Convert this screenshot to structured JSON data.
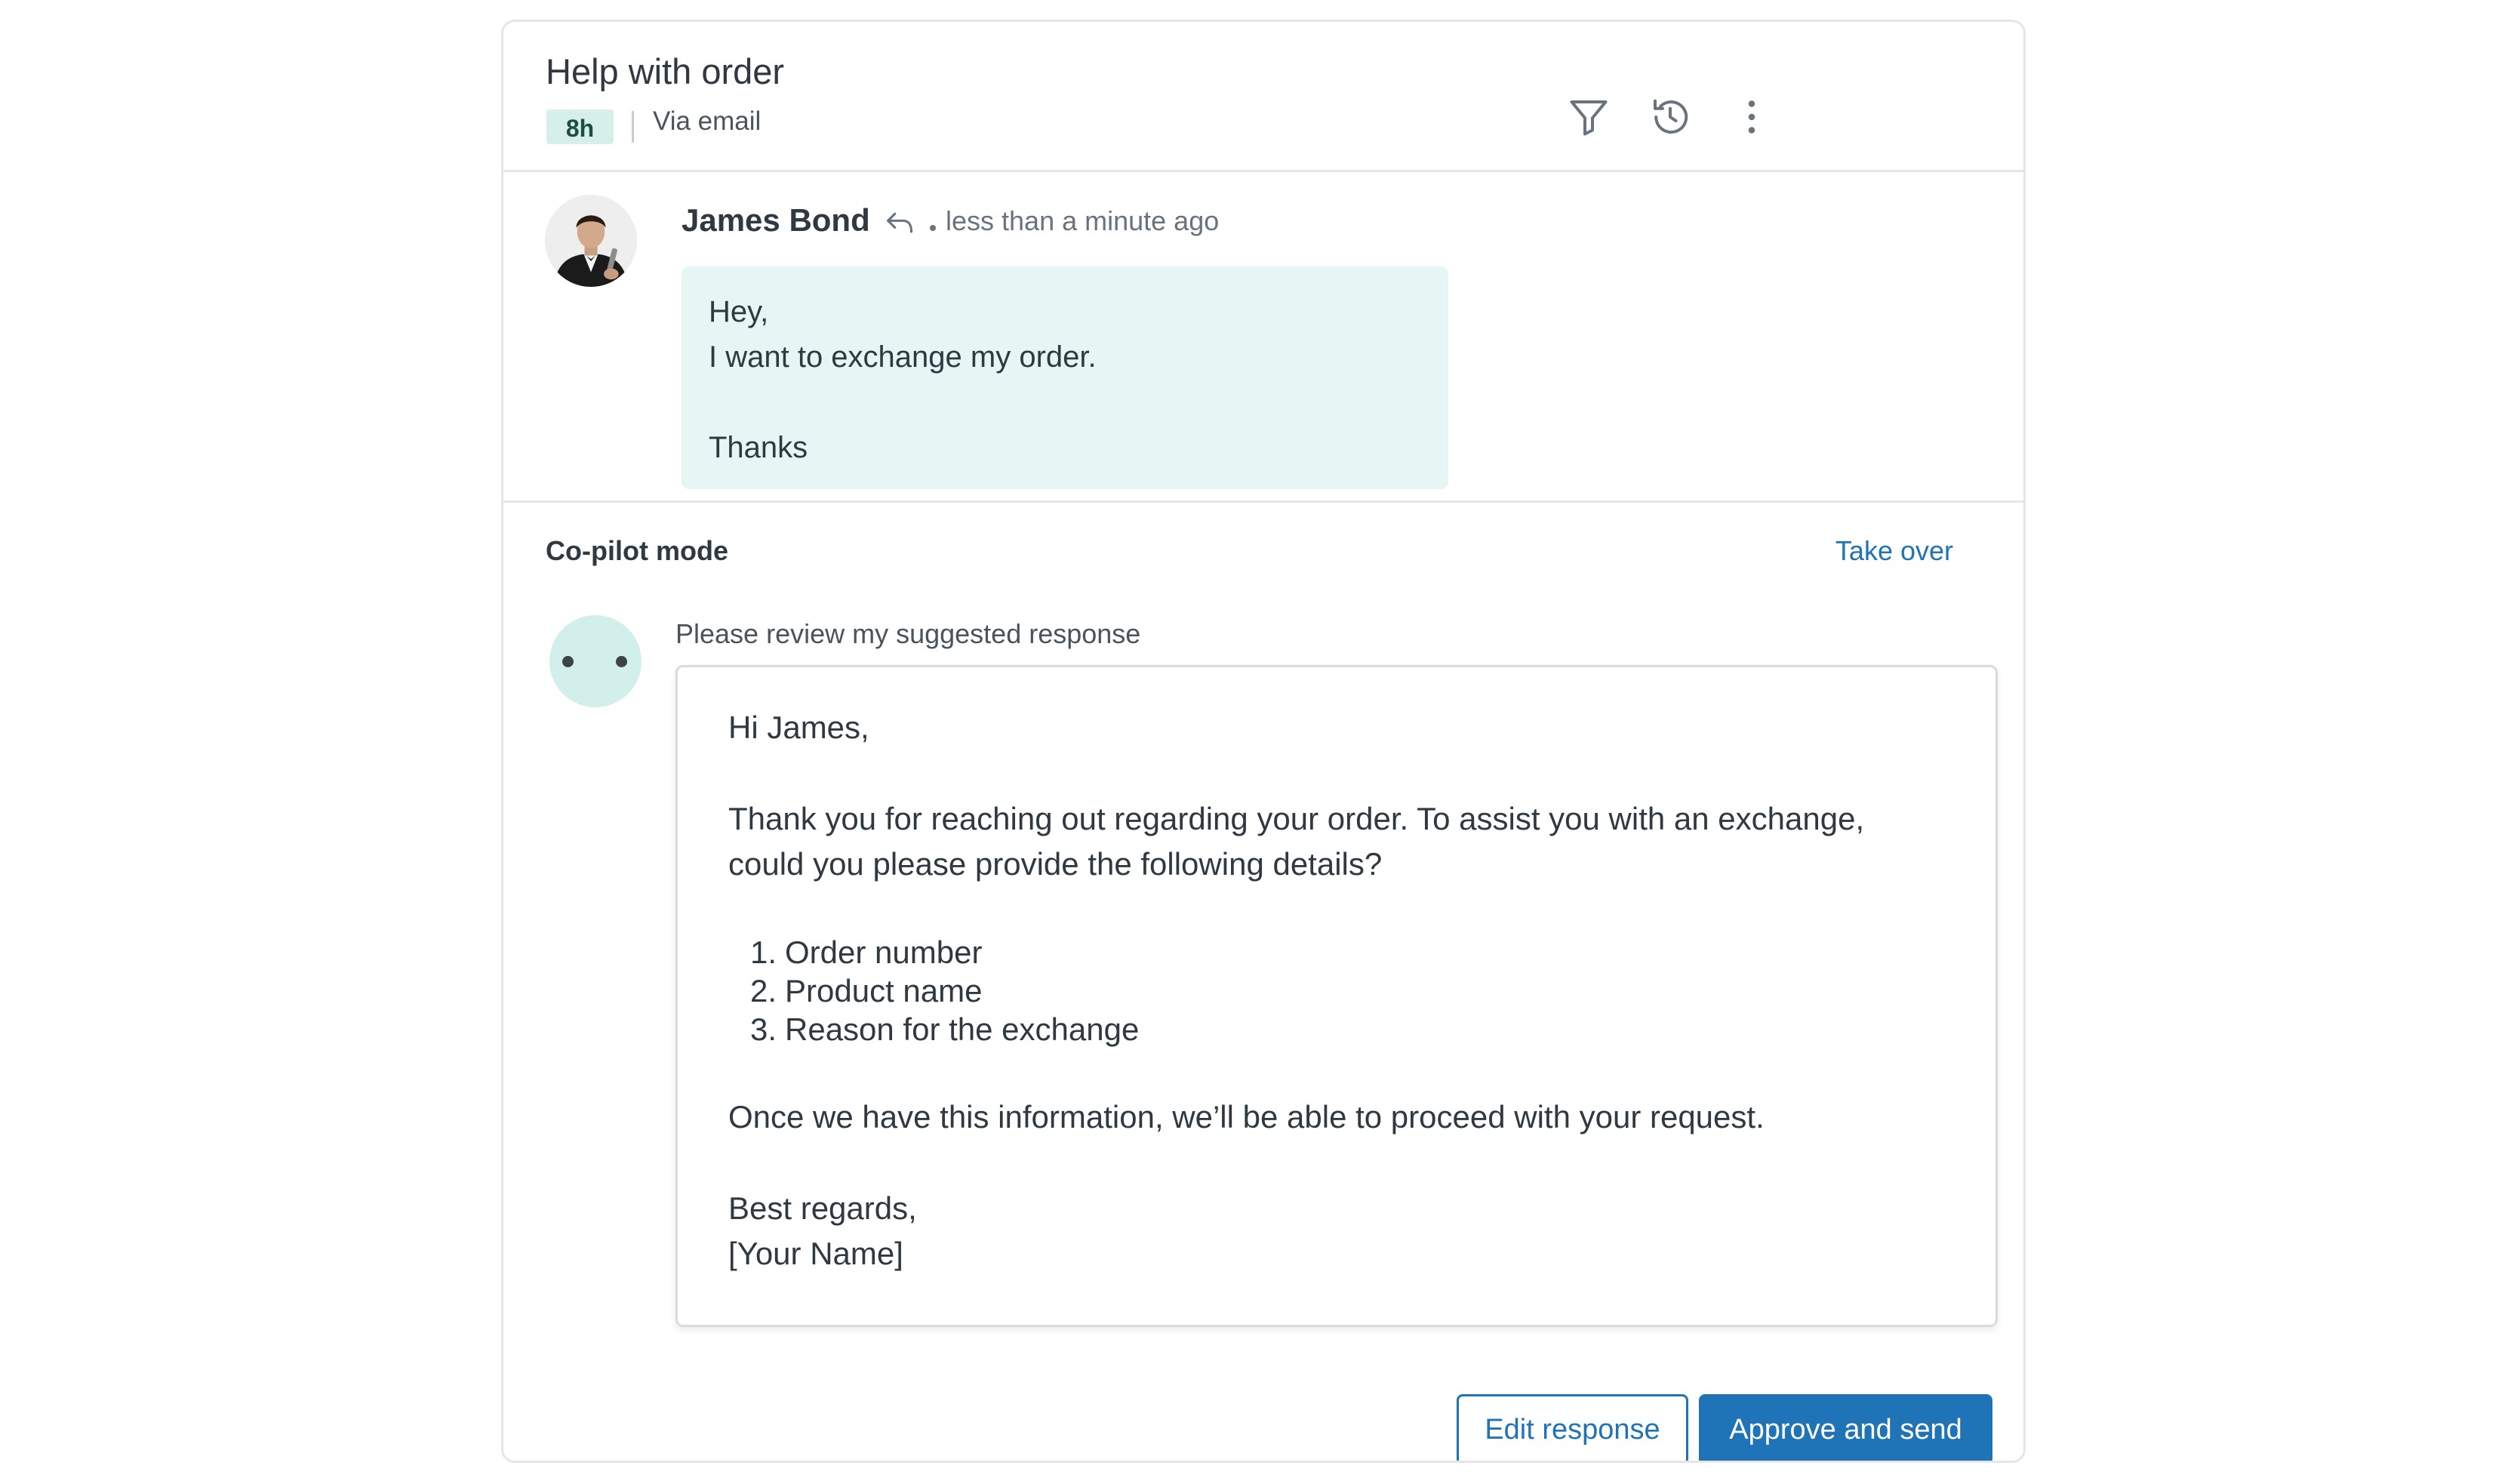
{
  "ticket": {
    "title": "Help with order",
    "age_badge": "8h",
    "channel": "Via email"
  },
  "toolbar": {
    "icons": [
      "filter-icon",
      "history-icon",
      "more-vertical-icon"
    ]
  },
  "message": {
    "author": "James Bond",
    "timestamp": "less than a minute ago",
    "body_lines": [
      "Hey,",
      "I want to exchange my order.",
      "",
      "Thanks"
    ]
  },
  "copilot": {
    "mode_label": "Co-pilot mode",
    "take_over_label": "Take over",
    "review_prompt": "Please review my suggested response",
    "suggestion": {
      "greeting": "Hi James,",
      "paragraph1": "Thank you for reaching out regarding your order. To assist you with an exchange, could you please provide the following details?",
      "list": [
        {
          "num": "1.",
          "text": "Order number"
        },
        {
          "num": "2.",
          "text": "Product name"
        },
        {
          "num": "3.",
          "text": "Reason for the exchange"
        }
      ],
      "paragraph2": "Once we have this information, we’ll be able to proceed with your request.",
      "closing": "Best regards,",
      "signature": "[Your Name]"
    },
    "edit_button_label": "Edit response",
    "approve_button_label": "Approve and send"
  },
  "colors": {
    "accent": "#1f73b7",
    "badge_bg": "#d6efe8",
    "bubble_bg": "#e6f6f4",
    "bot_avatar_bg": "#d3efeb"
  }
}
